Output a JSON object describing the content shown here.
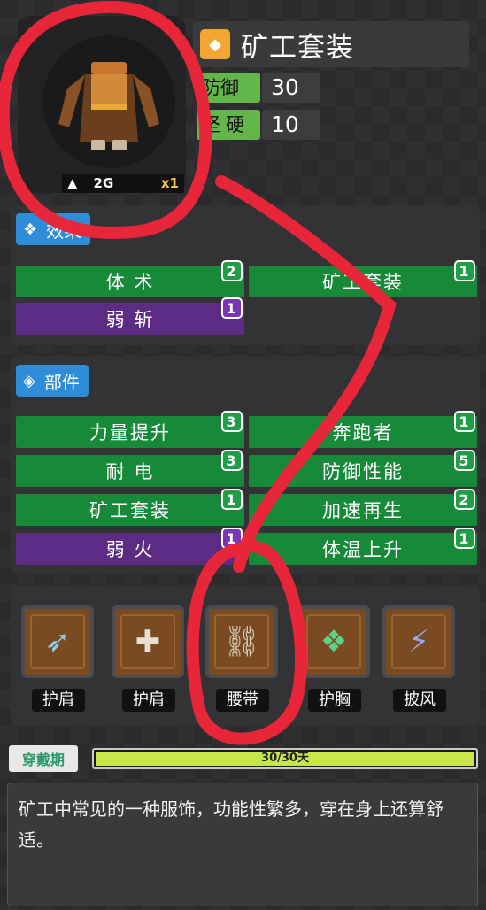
{
  "item": {
    "name": "矿工套装",
    "weight": "2G",
    "count": "x1",
    "stats": [
      {
        "label": "防御力",
        "value": "30"
      },
      {
        "label": "坚硬",
        "value": "10"
      }
    ]
  },
  "effects": {
    "title": "效果",
    "chips": [
      {
        "label": "体 术",
        "count": "2",
        "color": "green"
      },
      {
        "label": "矿工套装",
        "count": "1",
        "color": "green"
      },
      {
        "label": "弱 斩",
        "count": "1",
        "color": "purple"
      }
    ]
  },
  "parts": {
    "title": "部件",
    "chips": [
      {
        "label": "力量提升",
        "count": "3",
        "color": "green"
      },
      {
        "label": "奔跑者",
        "count": "1",
        "color": "green"
      },
      {
        "label": "耐 电",
        "count": "3",
        "color": "green"
      },
      {
        "label": "防御性能",
        "count": "5",
        "color": "green"
      },
      {
        "label": "矿工套装",
        "count": "1",
        "color": "green"
      },
      {
        "label": "加速再生",
        "count": "2",
        "color": "green"
      },
      {
        "label": "弱 火",
        "count": "1",
        "color": "purple"
      },
      {
        "label": "体温上升",
        "count": "1",
        "color": "green"
      }
    ]
  },
  "slots": [
    {
      "label": "护肩",
      "icon": "shoulder-guard-icon"
    },
    {
      "label": "护肩",
      "icon": "shoulder-add-icon"
    },
    {
      "label": "腰带",
      "icon": "belt-icon"
    },
    {
      "label": "护胸",
      "icon": "chest-guard-icon"
    },
    {
      "label": "披风",
      "icon": "cape-icon"
    }
  ],
  "duration": {
    "label": "穿戴期",
    "text": "30/30天",
    "fraction": 1.0
  },
  "description": "矿工中常见的一种服饰，功能性繁多，穿在身上还算舒适。",
  "colors": {
    "annotation": "#e8263a",
    "accent": "#2f8cd8",
    "green": "#178a3a",
    "purple": "#5c2b84"
  }
}
